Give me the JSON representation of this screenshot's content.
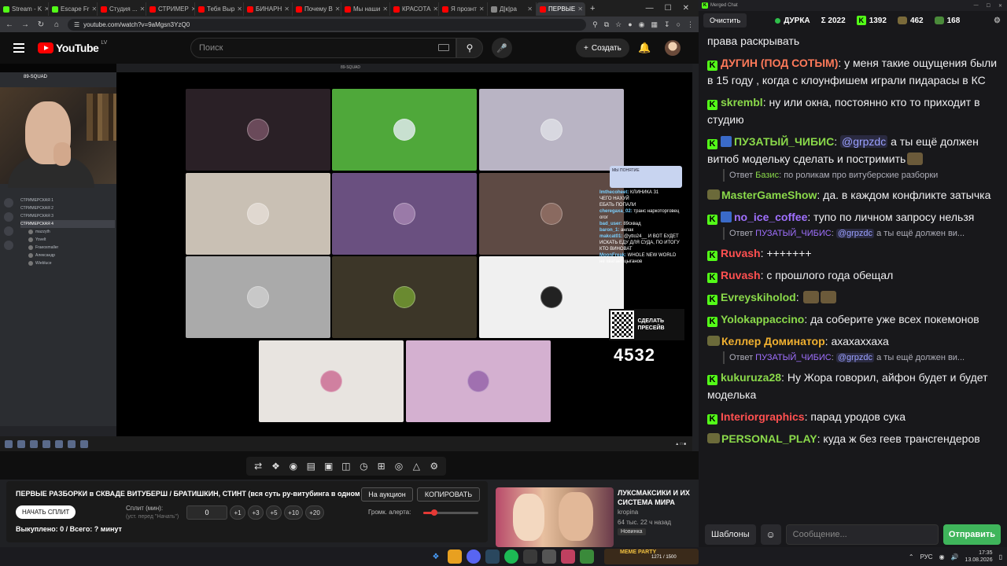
{
  "browser": {
    "tabs": [
      {
        "label": "Stream - K",
        "color": "#53fc18"
      },
      {
        "label": "Escape Fr",
        "color": "#53fc18"
      },
      {
        "label": "Студия ...",
        "color": "#ff0000"
      },
      {
        "label": "СТРИМЕР",
        "color": "#ff0000"
      },
      {
        "label": "Тебя Выр",
        "color": "#ff0000"
      },
      {
        "label": "БИНАРН",
        "color": "#ff0000"
      },
      {
        "label": "Почему В",
        "color": "#ff0000"
      },
      {
        "label": "Мы наши",
        "color": "#ff0000"
      },
      {
        "label": "КРАСОТА",
        "color": "#ff0000"
      },
      {
        "label": "Я прознт",
        "color": "#ff0000"
      },
      {
        "label": "Д|к|рa",
        "color": "#888888"
      },
      {
        "label": "ПЕРВЫЕ",
        "color": "#ff0000"
      }
    ],
    "new_tab": "+",
    "url": "youtube.com/watch?v=9aMgsn3YzQ0"
  },
  "youtube": {
    "logo": "YouTube",
    "region": "LV",
    "search_placeholder": "Поиск",
    "create_label": "Создать"
  },
  "stream_overlay": {
    "meet_title": "89-SQUAD",
    "server_name": "89-SQUAD",
    "channels": [
      "СТРИМЕРСКАЯ 1",
      "СТРИМЕРСКАЯ 2",
      "СТРИМЕРСКАЯ 3",
      "СТРИМЕРСКАЯ 4"
    ],
    "members": [
      "mazzyth",
      "Yovelt",
      "Fraeoxmaller",
      "Александр",
      "Wiebluce"
    ],
    "viewer_count": "4532",
    "qr_label": "СДЕЛАТЬ ПРЕСЕЙВ",
    "banner": "МЫ ПОНЯТИЕ",
    "chat_lines": [
      {
        "user": "Imthecoheet",
        "text": "КЛИНИКА 31"
      },
      {
        "user": "",
        "text": "ЧЕГО НАХУЙ"
      },
      {
        "user": "",
        "text": "ЕБАТЬ ПОПАЛИ"
      },
      {
        "user": "cheregaxa_02",
        "text": "транс наркоторговец"
      },
      {
        "user": "",
        "text": "огог"
      },
      {
        "user": "bad_user",
        "text": "89сквад"
      },
      {
        "user": "baron_1",
        "text": "анлак"
      },
      {
        "user": "makcat01",
        "text": "@ytto24__ И ВОТ БУДЕТ ИСКАТЬ ЕДУ ДЛЯ СУДА, ПО ИТОГУ КТО ВИНОВАТ"
      },
      {
        "user": "MoonFreak",
        "text": "WHOLE NEW WORLD"
      },
      {
        "user": "",
        "text": "не хватает цыганов"
      }
    ],
    "tiles": [
      {
        "bg": "#2a2026",
        "av": "#6a4a5a"
      },
      {
        "bg": "#4fa83a",
        "av": "#c8e0d0"
      },
      {
        "bg": "#b9b4c4",
        "av": "#d8d8e0"
      },
      {
        "bg": "#c9c0b4",
        "av": "#e0d8d0"
      },
      {
        "bg": "#6a5080",
        "av": "#9a7aa8"
      },
      {
        "bg": "#5e4a44",
        "av": "#8a6a60"
      },
      {
        "bg": "#aaaaaa",
        "av": "#c8c8c8"
      },
      {
        "bg": "#3c3628",
        "av": "#6a8a30"
      },
      {
        "bg": "#f0f0f0",
        "av": "#222222"
      },
      {
        "bg": "#e8e4e0",
        "av": "#d080a0"
      },
      {
        "bg": "#d4b0d0",
        "av": "#a070b0"
      }
    ]
  },
  "player": {
    "icons": [
      "loop-icon",
      "live-icon",
      "record-icon",
      "clip-icon",
      "frame-icon",
      "screen-icon",
      "speed-icon",
      "add-icon",
      "camera-icon",
      "lab-icon",
      "settings-icon"
    ]
  },
  "extension": {
    "title": "ПЕРВЫЕ РАЗБОРКИ в СКВАДЕ ВИТУБЕРШ / БРАТИШКИН, СТИНТ (вся суть ру-витубинга в одном видео)",
    "auction_label": "На аукцион",
    "copy_label": "КОПИРОВАТЬ",
    "split_button": "НАЧАТЬ СПЛИТ",
    "split_label": "Сплит (мин):",
    "split_hint": "(уст. перед \"Начать\")",
    "split_value": "0",
    "increments": [
      "+1",
      "+3",
      "+5",
      "+10",
      "+20"
    ],
    "volume_label": "Громк. алерта:",
    "volume_level": 0.2,
    "paid_text": "Выкуплено: 0 / Всего: ? минут"
  },
  "recommendation": {
    "title": "ЛУКСМАКСИКИ И ИХ СИСТЕМА МИРА",
    "channel": "kropina",
    "meta": "64 тыс.  22 ч назад",
    "badge": "Новинка"
  },
  "chat": {
    "window_title": "Merged Chat",
    "clear_label": "Очистить",
    "channel_name": "ДУРКА",
    "total_label": "Σ 2022",
    "kick_count": "1392",
    "emote_count": "462",
    "other_count": "168",
    "messages": [
      {
        "type": "plain",
        "text": "права раскрывать"
      },
      {
        "badge": "kick",
        "nick": "ДУГИН (ПОД СОТЫМ)",
        "color": "#ff7a5a",
        "text": "у меня такие ощущения были в 15 году , когда с клоунфишем играли пидарасы в КС"
      },
      {
        "badge": "kick",
        "nick": "skrembl",
        "color": "#8ad94a",
        "text": "ну или окна, постоянно кто то приходит в студию"
      },
      {
        "badge": "kick+sub",
        "nick": "ПУЗАТЫЙ_ЧИБИС",
        "color": "#8ad94a",
        "mention": "@grpzdc",
        "text": "а ты ещё должен витюб модельку сделать и постримить"
      },
      {
        "type": "reply",
        "prefix": "Ответ",
        "reply_nick": "Базис",
        "reply_color": "#8ad94a",
        "text": "по роликам про витуберские разборки"
      },
      {
        "badge": "emote",
        "nick": "MasterGameShow",
        "color": "#8ad94a",
        "text": "да. в каждом конфликте затычка"
      },
      {
        "badge": "kick+sub",
        "nick": "no_ice_coffee",
        "color": "#a070ff",
        "text": "тупо по личном запросу нельзя"
      },
      {
        "type": "reply",
        "prefix": "Ответ",
        "reply_nick": "ПУЗАТЫЙ_ЧИБИС",
        "reply_color": "#a070ff",
        "mention": "@grpzdc",
        "text": "а ты ещё должен ви..."
      },
      {
        "badge": "kick",
        "nick": "Ruvash",
        "color": "#ff5050",
        "text": "+++++++"
      },
      {
        "badge": "kick",
        "nick": "Ruvash",
        "color": "#ff5050",
        "text": "с прошлого года обещал"
      },
      {
        "badge": "kick",
        "nick": "Evreyskiholod",
        "color": "#8ad94a",
        "text": ""
      },
      {
        "badge": "kick",
        "nick": "Yolokappaccino",
        "color": "#8ad94a",
        "text": "да соберите уже всех покемонов"
      },
      {
        "badge": "emote",
        "nick": "Келлер Доминатор",
        "color": "#f0b030",
        "text": "ахахаххаха"
      },
      {
        "type": "reply",
        "prefix": "Ответ",
        "reply_nick": "ПУЗАТЫЙ_ЧИБИС",
        "reply_color": "#a070ff",
        "mention": "@grpzdc",
        "text": "а ты ещё должен ви..."
      },
      {
        "badge": "kick",
        "nick": "kukuruza28",
        "color": "#8ad94a",
        "text": "Ну Жора говорил, айфон будет и будет моделька"
      },
      {
        "badge": "kick",
        "nick": "Interiorgraphics",
        "color": "#ff5050",
        "text": "парад уродов сука"
      },
      {
        "badge": "emote",
        "nick": "PERSONAL_PLAY",
        "color": "#8ad94a",
        "text": "куда ж без геев трансгендеров"
      }
    ],
    "templates_label": "Шаблоны",
    "input_placeholder": "Сообщение...",
    "send_label": "Отправить"
  },
  "taskbar": {
    "stream_title": "MEME PARTY",
    "stream_progress": "1271 / 1500",
    "lang": "РУС",
    "time": "17:35",
    "date": "13.08.2026"
  }
}
